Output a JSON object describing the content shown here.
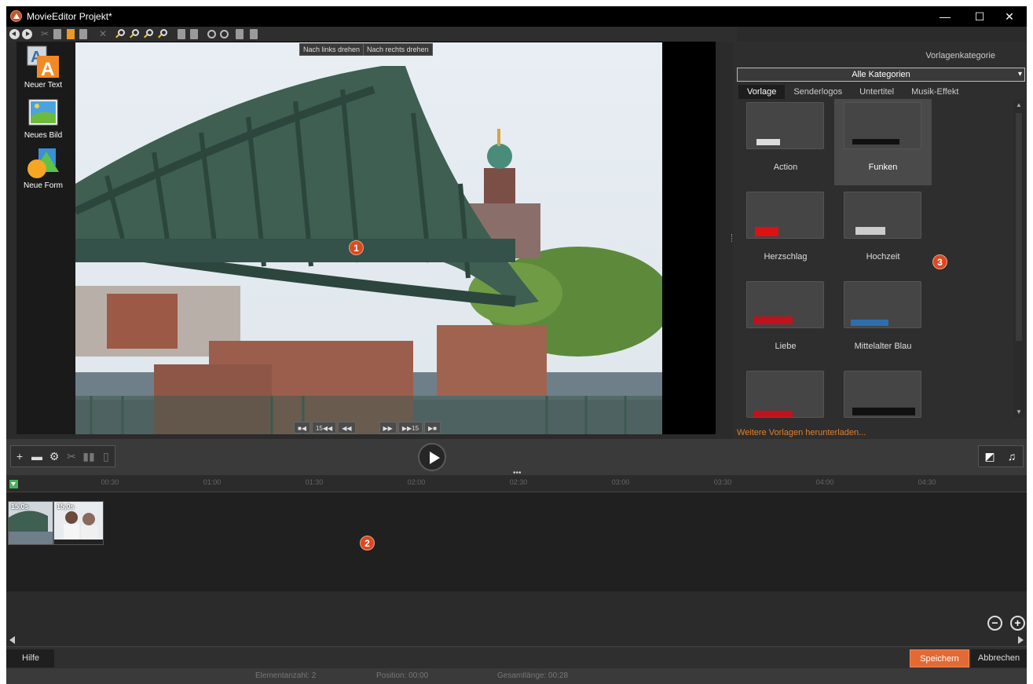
{
  "window": {
    "title": "MovieEditor Projekt*",
    "minimize": "—",
    "maximize": "☐",
    "close": "✕"
  },
  "left_tools": [
    {
      "label": "Neuer Text"
    },
    {
      "label": "Neues Bild"
    },
    {
      "label": "Neue Form"
    }
  ],
  "preview": {
    "rotate_left": "Nach links drehen",
    "rotate_right": "Nach rechts drehen",
    "transport": [
      "■◀",
      "15◀◀",
      "◀◀",
      "▶▶",
      "▶▶15",
      "▶■"
    ],
    "marker": "1"
  },
  "right_panel": {
    "category_label": "Vorlagenkategorie",
    "category_value": "Alle Kategorien",
    "tabs": [
      "Vorlage",
      "Senderlogos",
      "Untertitel",
      "Musik-Effekt"
    ],
    "templates": [
      {
        "name": "Action"
      },
      {
        "name": "Funken"
      },
      {
        "name": "Herzschlag"
      },
      {
        "name": "Hochzeit"
      },
      {
        "name": "Liebe"
      },
      {
        "name": "Mittelalter Blau"
      },
      {
        "name": ""
      },
      {
        "name": ""
      }
    ],
    "more_link": "Weitere Vorlagen herunterladen...",
    "marker": "3"
  },
  "timeline": {
    "ticks": [
      "00:30",
      "01:00",
      "01:30",
      "02:00",
      "02:30",
      "03:00",
      "03:30",
      "04:00",
      "04:30"
    ],
    "clips": [
      {
        "duration": "15,0s"
      },
      {
        "duration": "15,0s"
      }
    ],
    "marker": "2",
    "splitter": "•••"
  },
  "bottom": {
    "help": "Hilfe",
    "save": "Speichern",
    "cancel": "Abbrechen"
  },
  "status": {
    "element_count": "Elementanzahl: 2",
    "position": "Position: 00:00",
    "total_length": "Gesamtlänge: 00:28"
  },
  "colors": {
    "accent": "#e26a35",
    "link": "#e07f2a",
    "marker": "#d84a23"
  }
}
